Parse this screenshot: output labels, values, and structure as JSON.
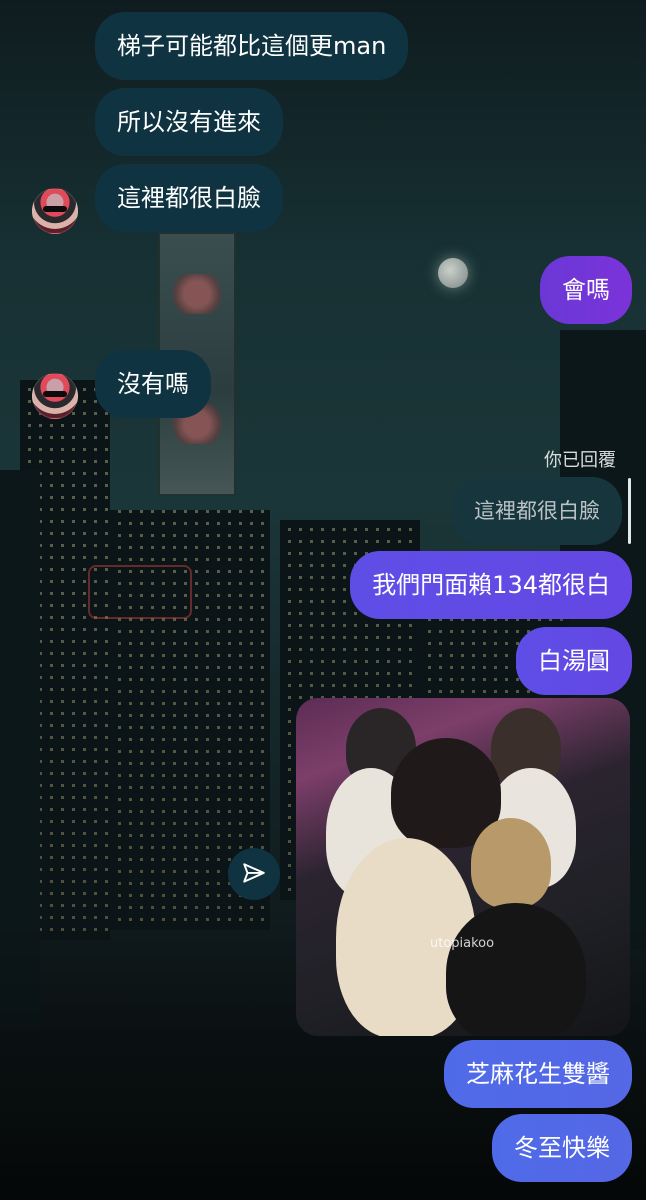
{
  "messages": {
    "m1": "梯子可能都比這個更man",
    "m2": "所以沒有進來",
    "m3": "這裡都很白臉",
    "m4": "會嗎",
    "m5": "沒有嗎",
    "reply_label": "你已回覆",
    "quoted": "這裡都很白臉",
    "m6": "我們門面賴134都很白",
    "m7": "白湯圓",
    "photo_watermark": "utopiakoo",
    "m8": "芝麻花生雙醬",
    "m9": "冬至快樂"
  },
  "icons": {
    "share": "send-icon",
    "avatar": "user-avatar"
  },
  "colors": {
    "incoming_bubble": "#0f3340",
    "outgoing_purple": "#6a38d6",
    "outgoing_violet": "#5e4ee6",
    "outgoing_blue": "#4f6ae8"
  }
}
